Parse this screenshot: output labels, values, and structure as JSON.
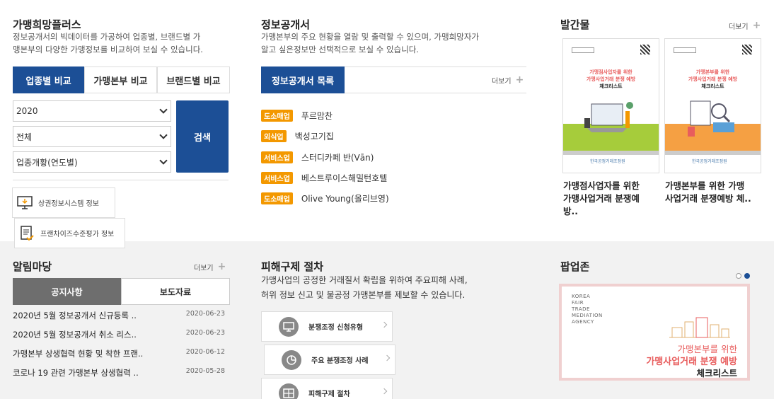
{
  "plus": {
    "title": "가맹희망플러스",
    "desc_line1": "정보공개서의 빅데이터를 가공하여 업종별, 브랜드별 가",
    "desc_line2": "맹본부의 다양한 가맹정보를 비교하여 보실 수 있습니다.",
    "tabs": [
      "업종별 비교",
      "가맹본부 비교",
      "브랜드별 비교"
    ],
    "year_select": "2020",
    "category_select": "전체",
    "type_select": "업종개황(연도별)",
    "search_label": "검색",
    "link1": "상권정보시스템 정보",
    "link2": "프랜차이즈수준평가 정보"
  },
  "disclosure": {
    "title": "정보공개서",
    "desc_line1": "가맹본부의 주요 현황을 열람 및 출력할 수 있으며, 가맹희망자가",
    "desc_line2": "알고 싶은정보만 선택적으로 보실 수 있습니다.",
    "list_tab": "정보공개서 목록",
    "more": "더보기",
    "items": [
      {
        "badge": "도소매업",
        "name": "푸르맘찬"
      },
      {
        "badge": "외식업",
        "name": "백성고기집"
      },
      {
        "badge": "서비스업",
        "name": "스터디카페 반(Vān)"
      },
      {
        "badge": "서비스업",
        "name": "베스트루이스해밀턴호텔"
      },
      {
        "badge": "도소매업",
        "name": "Olive Young(올리브영)"
      }
    ]
  },
  "publications": {
    "title": "발간물",
    "more": "더보기",
    "books": [
      {
        "cover_line1": "가맹점사업자를 위한",
        "cover_line2": "가맹사업거래 분쟁 예방",
        "cover_line3": "체크리스트",
        "cover_logo": "한국공정거래조정원",
        "title_line1": "가맹점사업자를 위한",
        "title_line2": "가맹사업거래 분쟁예",
        "title_line3": "방.."
      },
      {
        "cover_line1": "가맹본부를 위한",
        "cover_line2": "가맹사업거래 분쟁 예방",
        "cover_line3": "체크리스트",
        "cover_logo": "한국공정거래조정원",
        "title_line1": "가맹본부를 위한 가맹",
        "title_line2": "사업거래 분쟁예방 체..",
        "title_line3": ""
      }
    ]
  },
  "notice": {
    "title": "알림마당",
    "more": "더보기",
    "tabs": [
      "공지사항",
      "보도자료"
    ],
    "items": [
      {
        "text": "2020년 5월 정보공개서 신규등록 ..",
        "date": "2020-06-23"
      },
      {
        "text": "2020년 5월 정보공개서 취소 리스..",
        "date": "2020-06-23"
      },
      {
        "text": "가맹본부 상생협력 현황 및 착한 프랜..",
        "date": "2020-06-12"
      },
      {
        "text": "코로나 19 관련 가맹본부 상생협력 ..",
        "date": "2020-05-28"
      }
    ]
  },
  "relief": {
    "title": "피해구제 절차",
    "desc_line1": "가맹사업의 공정한 거래질서 확립을 위하여 주요피해 사례,",
    "desc_line2": "허위 정보 신고 및 불공정 가맹본부를 제보할 수 있습니다.",
    "buttons": [
      "분쟁조정 신청유형",
      "주요 분쟁조정 사례",
      "피해구제 절차"
    ]
  },
  "popup": {
    "title": "팝업존",
    "korea_lines": [
      "KOREA",
      "FAIR",
      "TRADE",
      "MEDIATION",
      "AGENCY"
    ],
    "line1": "가맹본부를 위한",
    "line2": "가맹사업거래 분쟁 예방",
    "line3": "체크리스트"
  },
  "colors": {
    "primary": "#1c4f96",
    "badge": "#f39800",
    "notice_active": "#6e6e6e",
    "popup_accent": "#e85d5d"
  }
}
